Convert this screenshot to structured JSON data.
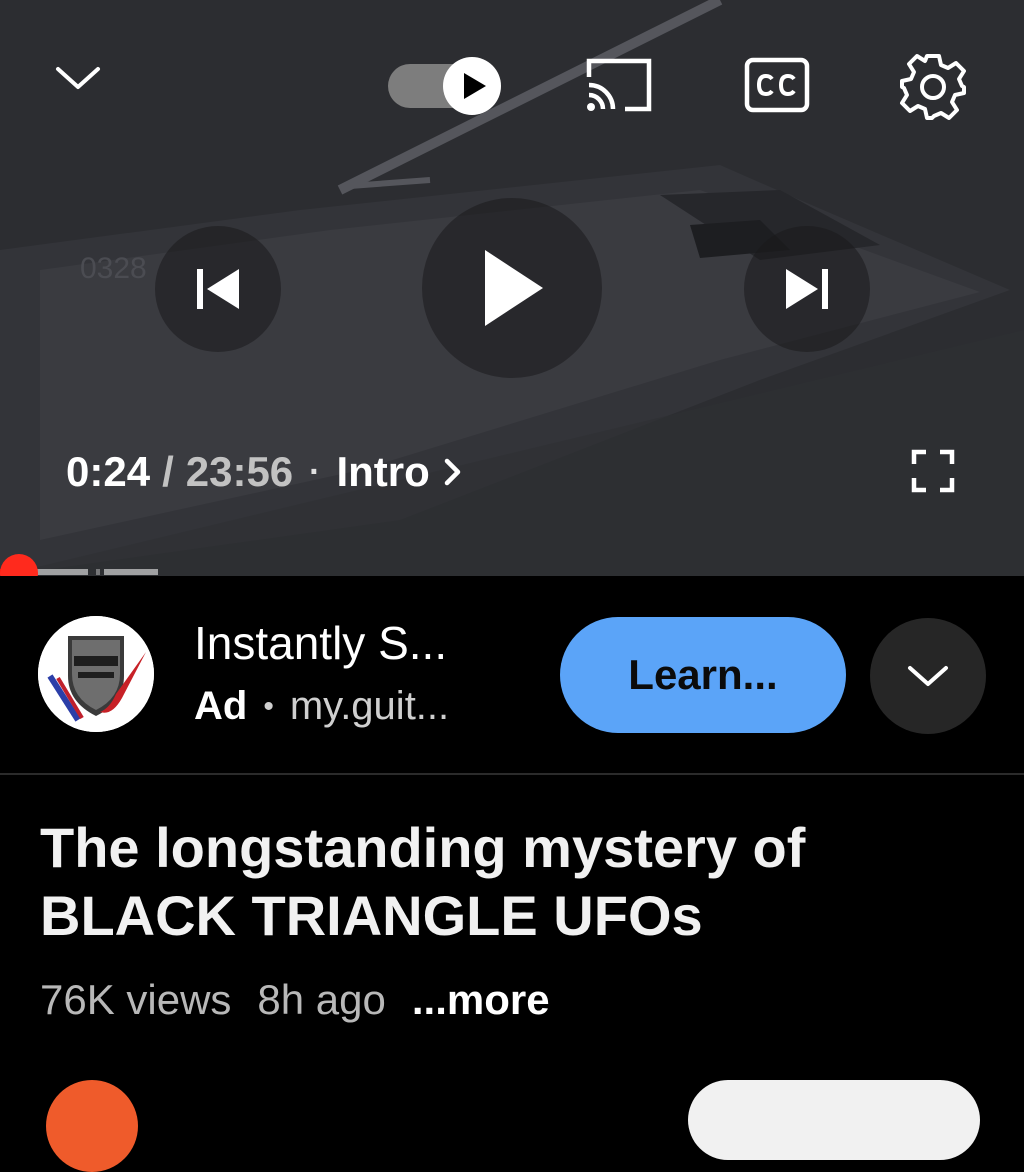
{
  "player": {
    "current_time": "0:24",
    "separator": "/",
    "duration": "23:56",
    "dot": "·",
    "chapter": "Intro",
    "progress_fraction": 0.017
  },
  "ad": {
    "title": "Instantly S...",
    "badge": "Ad",
    "dot": "•",
    "domain": "my.guit...",
    "cta_label": "Learn..."
  },
  "video": {
    "title": "The longstanding mystery of BLACK TRIANGLE UFOs",
    "views": "76K views",
    "age": "8h ago",
    "more_label": "...more"
  },
  "icons": {
    "collapse": "chevron-down-icon",
    "autoplay": "autoplay-toggle-icon",
    "cast": "cast-icon",
    "cc": "closed-captions-icon",
    "settings": "gear-icon",
    "previous": "skip-previous-icon",
    "play": "play-icon",
    "next": "skip-next-icon",
    "fullscreen": "fullscreen-icon",
    "expand": "chevron-down-icon"
  },
  "colors": {
    "progress": "#ff0000",
    "cta_background": "#5ba4f8",
    "background": "#000000"
  }
}
